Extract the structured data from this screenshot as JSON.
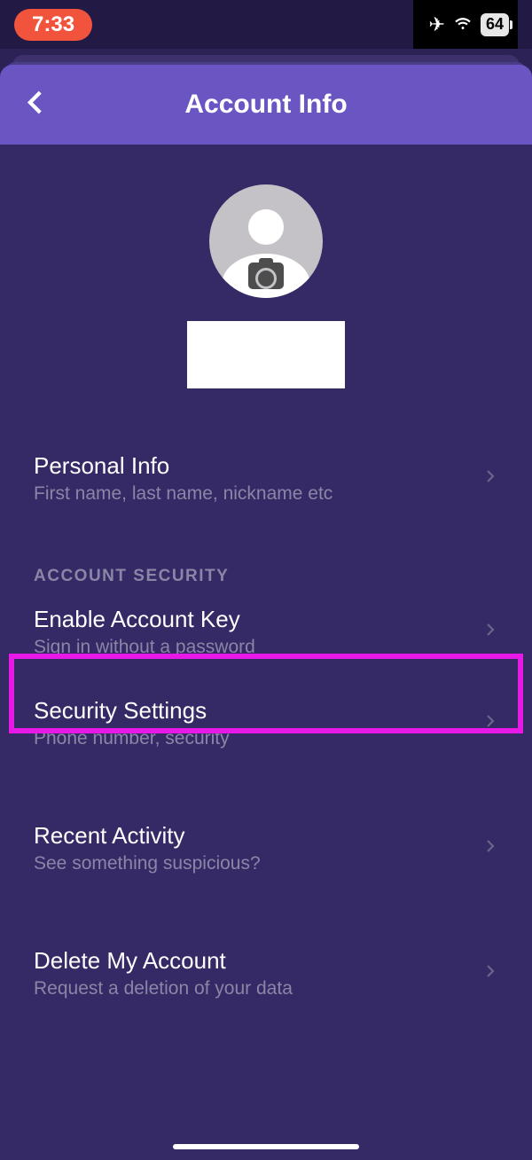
{
  "status": {
    "time": "7:33",
    "battery": "64"
  },
  "header": {
    "title": "Account Info"
  },
  "rows": {
    "personal": {
      "title": "Personal Info",
      "sub": "First name, last name, nickname etc"
    },
    "section_security": "ACCOUNT SECURITY",
    "enable_key": {
      "title": "Enable Account Key",
      "sub": "Sign in without a password"
    },
    "security": {
      "title": "Security Settings",
      "sub": "Phone number, security"
    },
    "recent": {
      "title": "Recent Activity",
      "sub": "See something suspicious?"
    },
    "delete": {
      "title": "Delete My Account",
      "sub": "Request a deletion of your data"
    }
  }
}
